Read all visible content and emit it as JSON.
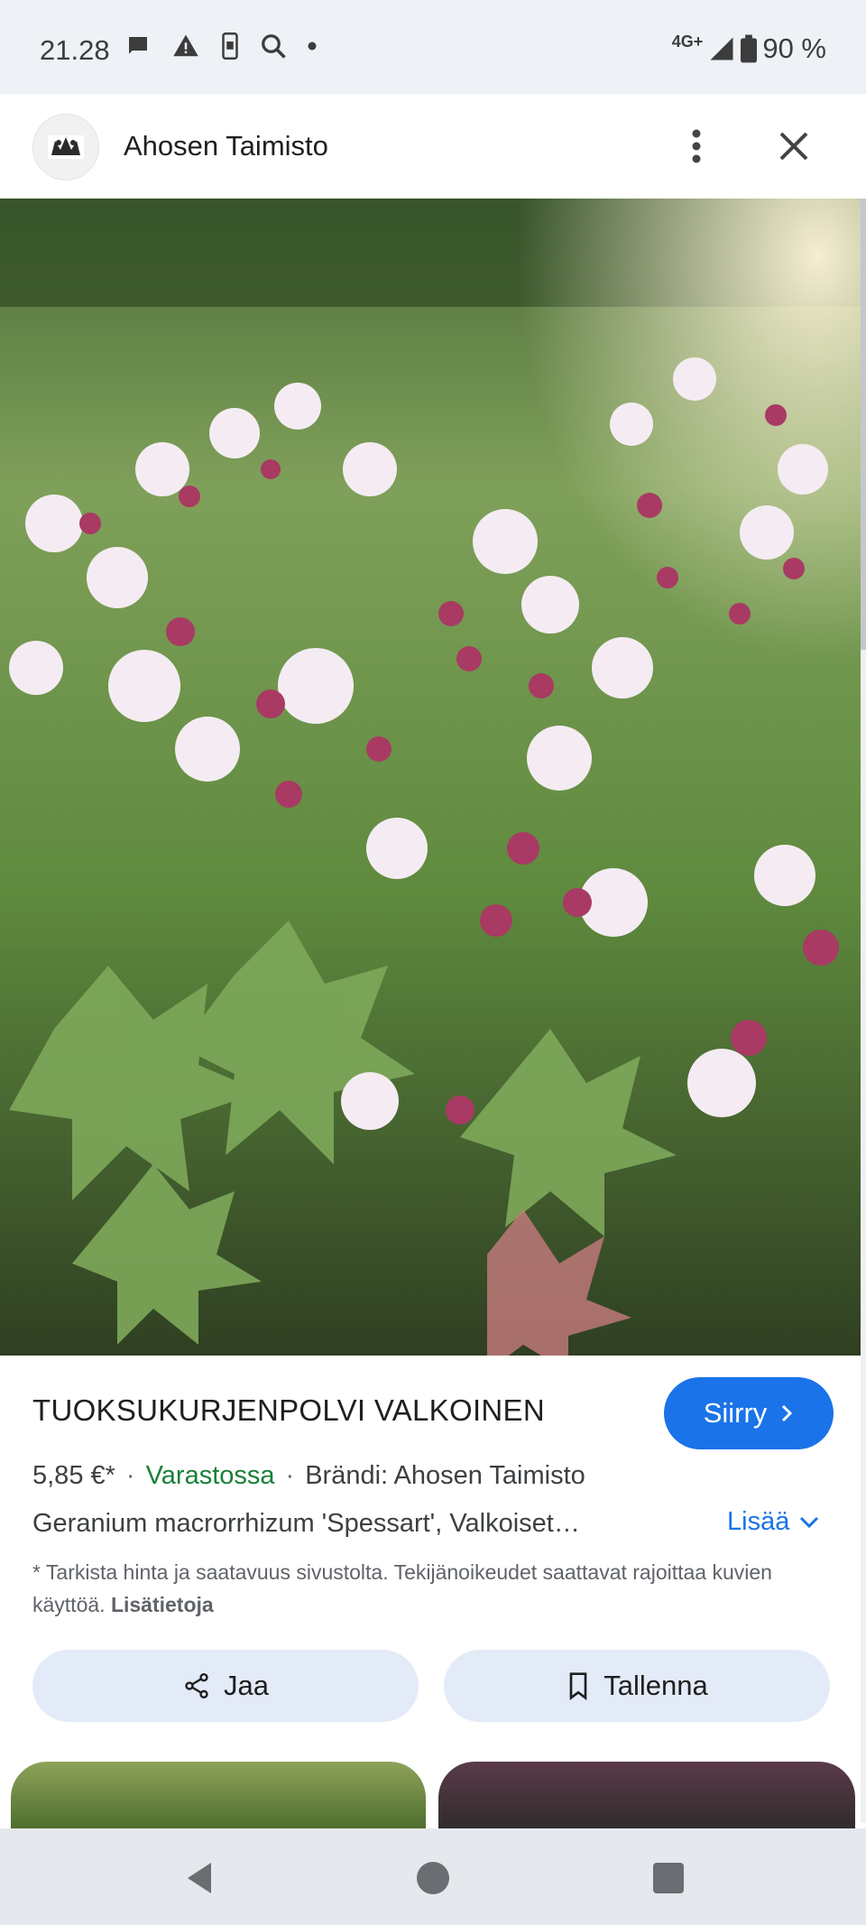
{
  "status_bar": {
    "time": "21.28",
    "network": "4G+",
    "battery": "90 %",
    "icons": [
      "chat-bubble-icon",
      "warning-icon",
      "phone-icon",
      "search-icon",
      "dot-icon",
      "signal-icon",
      "battery-icon"
    ]
  },
  "header": {
    "site_name": "Ahosen Taimisto",
    "more_icon": "more-vert-icon",
    "close_icon": "close-icon"
  },
  "product": {
    "title": "TUOKSUKURJENPOLVI VALKOINEN",
    "go_label": "Siirry",
    "price": "5,85 €*",
    "stock": "Varastossa",
    "brand": "Brändi: Ahosen Taimisto",
    "description": "Geranium macrorrhizum 'Spessart', Valkoiset…",
    "more_label": "Lisää",
    "disclaimer": "* Tarkista hinta ja saatavuus sivustolta. Tekijänoikeudet saattavat rajoittaa kuvien käyttöä.",
    "disclaimer_link": "Lisätietoja"
  },
  "actions": {
    "share_label": "Jaa",
    "save_label": "Tallenna"
  },
  "colors": {
    "accent": "#1a73e8",
    "stock_green": "#188038",
    "pill_bg": "#e4ebf8"
  }
}
